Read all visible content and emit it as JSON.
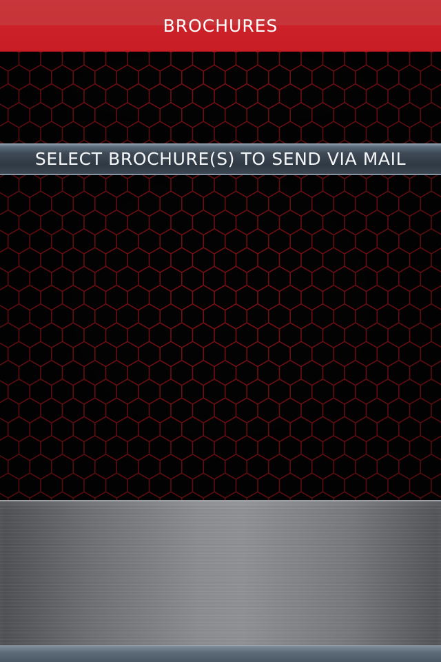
{
  "header": {
    "title": "BROCHURES"
  },
  "instruction": {
    "text": "SELECT BROCHURE(S) TO SEND VIA MAIL"
  },
  "brochure_list": {
    "items": []
  },
  "colors": {
    "header_red": "#c81d24",
    "mesh_line": "#7a1014",
    "mesh_bg": "#030303",
    "instruction_band": "#2f3943",
    "metal": "#8a8c90",
    "bottom_bar": "#5d6b79"
  }
}
